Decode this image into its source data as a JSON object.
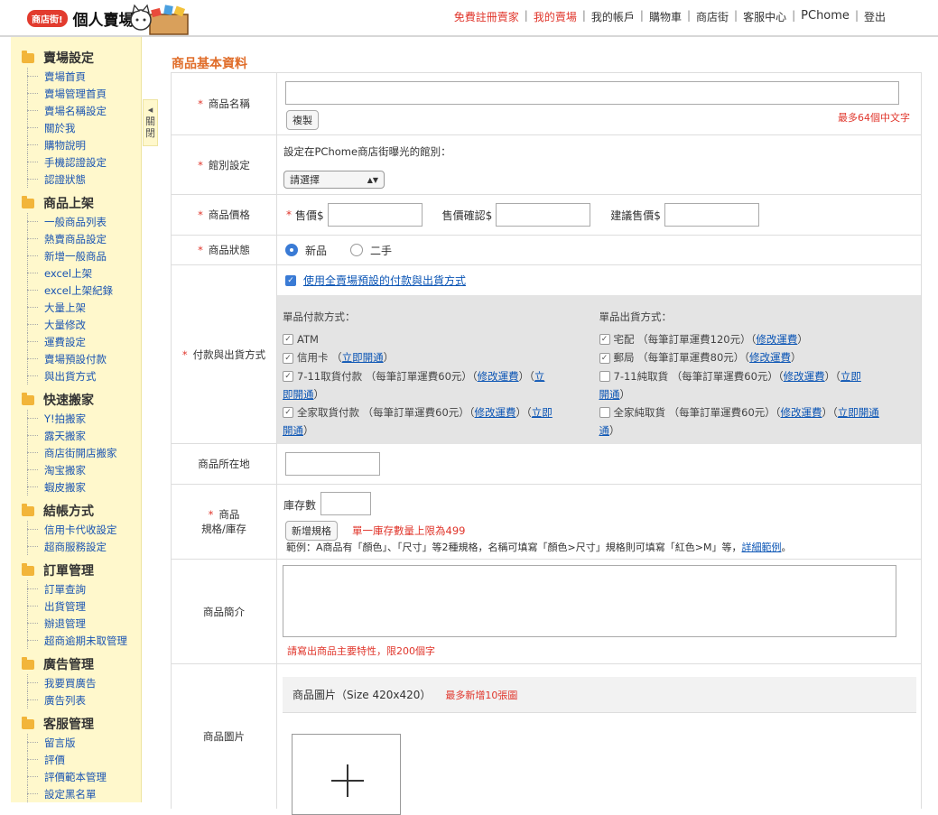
{
  "header": {
    "badge": "商店街!",
    "title": "個人賣場",
    "nav": [
      {
        "label": "免費註冊賣家",
        "red": true
      },
      {
        "label": "我的賣場",
        "red": true
      },
      {
        "label": "我的帳戶",
        "red": false
      },
      {
        "label": "購物車",
        "red": false
      },
      {
        "label": "商店街",
        "red": false
      },
      {
        "label": "客服中心",
        "red": false
      },
      {
        "label": "PChome",
        "red": false
      },
      {
        "label": "登出",
        "red": false
      }
    ]
  },
  "sidebar": {
    "toggle_label": "關閉",
    "groups": [
      {
        "title": "賣場設定",
        "items": [
          "賣場首頁",
          "賣場管理首頁",
          "賣場名稱設定",
          "關於我",
          "購物說明",
          "手機認證設定",
          "認證狀態"
        ]
      },
      {
        "title": "商品上架",
        "items": [
          "一般商品列表",
          "熱賣商品設定",
          "新增一般商品",
          "excel上架",
          "excel上架紀錄",
          "大量上架",
          "大量修改",
          "運費設定",
          "賣場預設付款",
          "與出貨方式"
        ]
      },
      {
        "title": "快速搬家",
        "items": [
          "Y!拍搬家",
          "露天搬家",
          "商店街開店搬家",
          "淘宝搬家",
          "蝦皮搬家"
        ]
      },
      {
        "title": "結帳方式",
        "items": [
          "信用卡代收設定",
          "超商服務設定"
        ]
      },
      {
        "title": "訂單管理",
        "items": [
          "訂單查詢",
          "出貨管理",
          "辦退管理",
          "超商逾期未取管理"
        ]
      },
      {
        "title": "廣告管理",
        "items": [
          "我要買廣告",
          "廣告列表"
        ]
      },
      {
        "title": "客服管理",
        "items": [
          "留言版",
          "評價",
          "評價範本管理",
          "設定黑名單"
        ]
      }
    ]
  },
  "main": {
    "section_title": "商品基本資料",
    "name": {
      "label": "商品名稱",
      "copy_button": "複製",
      "hint": "最多64個中文字"
    },
    "category": {
      "label": "館別設定",
      "desc": "設定在PChome商店街曝光的館別：",
      "select_value": "請選擇"
    },
    "price": {
      "label": "商品價格",
      "sale_label": "售價$",
      "confirm_label": "售價確認$",
      "suggest_label": "建議售價$"
    },
    "status": {
      "label": "商品狀態",
      "opt_new": "新品",
      "opt_used": "二手"
    },
    "payment": {
      "label": "付款與出貨方式",
      "use_default": "使用全賣場預設的付款與出貨方式",
      "pay_title": "單品付款方式：",
      "ship_title": "單品出貨方式：",
      "pay_atm": "ATM",
      "pay_cc": "信用卡",
      "pay_cc_link": "立即開通",
      "pay_711": "7-11取貨付款 （每筆訂單運費60元）（",
      "pay_711_link1": "修改運費",
      "pay_711_mid": "）（",
      "pay_711_link2a": "立",
      "pay_711_link2b": "即開通",
      "pay_fm": "全家取貨付款 （每筆訂單運費60元）（",
      "pay_fm_link1": "修改運費",
      "pay_fm_mid": "）（",
      "pay_fm_link2a": "立即",
      "pay_fm_link2b": "開通",
      "ship_home": "宅配 （每筆訂單運費120元）（",
      "ship_home_link": "修改運費",
      "ship_post": "郵局 （每筆訂單運費80元）（",
      "ship_post_link": "修改運費",
      "ship_711": "7-11純取貨 （每筆訂單運費60元）（",
      "ship_711_link1": "修改運費",
      "ship_711_mid": "）（",
      "ship_711_link2a": "立即",
      "ship_711_link2b": "開通",
      "ship_fm": "全家純取貨 （每筆訂單運費60元）（",
      "ship_fm_link1": "修改運費",
      "ship_fm_mid": "）（",
      "ship_fm_link2a": "立即開通",
      "ship_fm_link2b": "通",
      "close_paren": "）",
      "open_paren": "（"
    },
    "location": {
      "label": "商品所在地"
    },
    "spec": {
      "label_1": "商品",
      "label_2": "規格/庫存",
      "stock_label": "庫存數",
      "add_button": "新增規格",
      "limit_note": "單一庫存數量上限為499",
      "example": "範例：A商品有「顏色」、「尺寸」等2種規格，名稱可填寫「顏色>尺寸」規格則可填寫「紅色>M」等，",
      "example_link": "詳細範例",
      "example_end": "。"
    },
    "intro": {
      "label": "商品簡介",
      "hint": "請寫出商品主要特性，限200個字"
    },
    "images": {
      "label": "商品圖片",
      "title": "商品圖片（Size 420x420）",
      "limit": "最多新增10張圖"
    }
  }
}
